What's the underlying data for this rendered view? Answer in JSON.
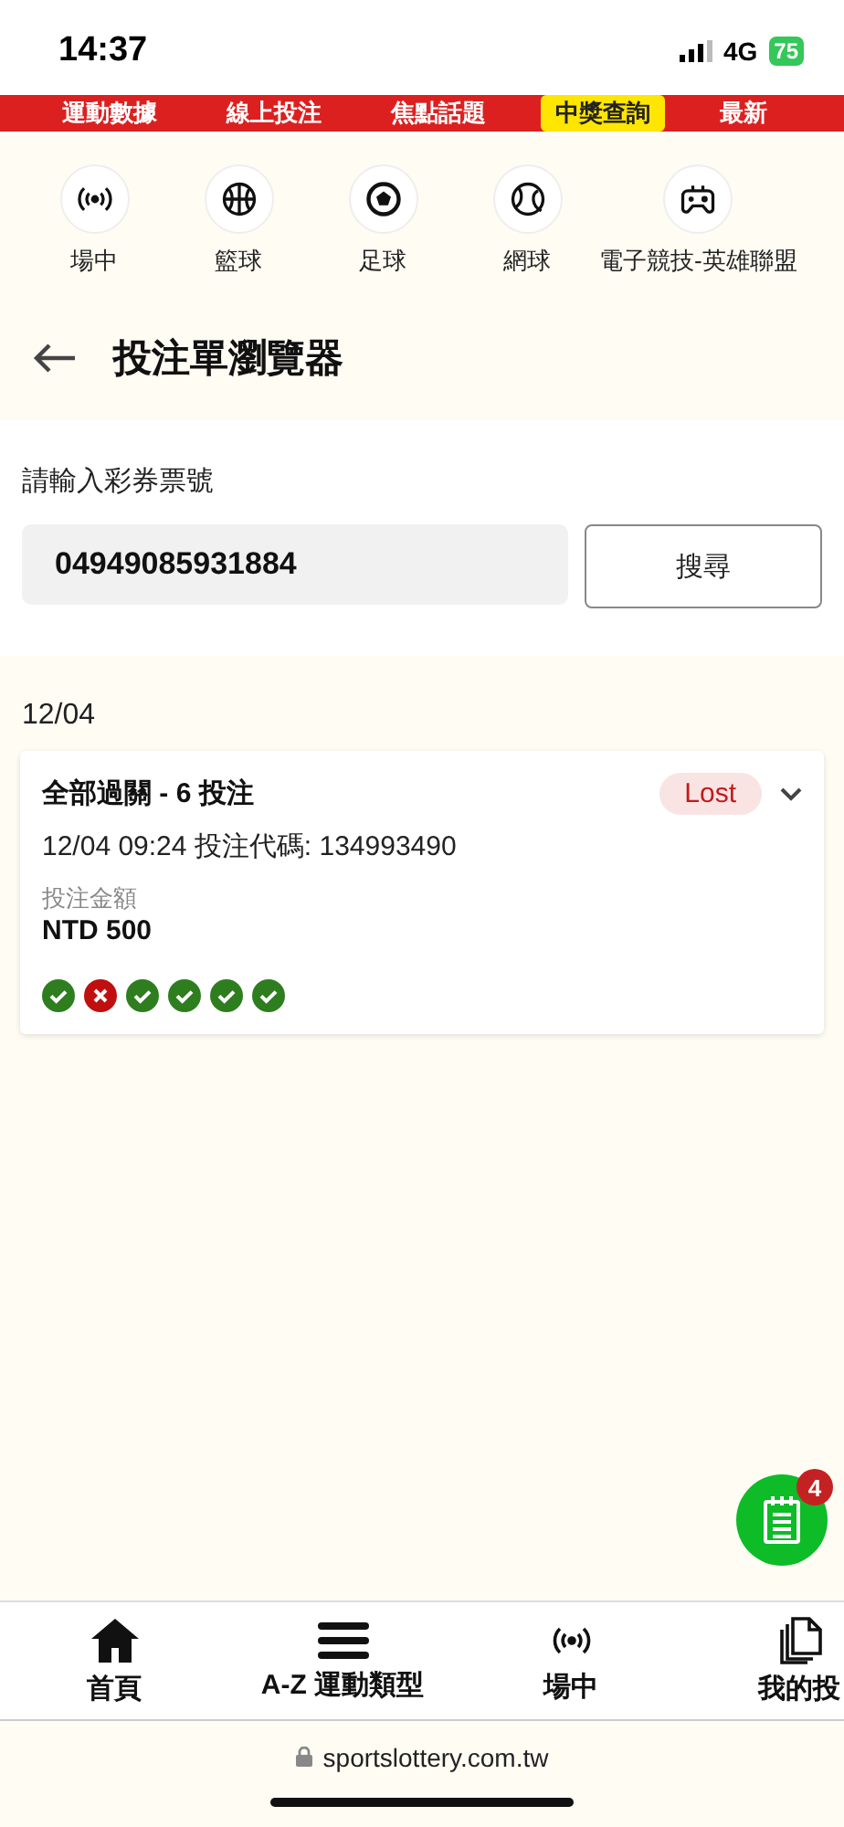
{
  "status_bar": {
    "time": "14:37",
    "network": "4G",
    "battery": "75"
  },
  "top_menu": [
    {
      "label": "運動數據",
      "selected": false
    },
    {
      "label": "線上投注",
      "selected": false
    },
    {
      "label": "焦點話題",
      "selected": false
    },
    {
      "label": "中獎查詢",
      "selected": true
    },
    {
      "label": "最新",
      "selected": false
    }
  ],
  "sports": [
    {
      "kind": "live",
      "label": "場中"
    },
    {
      "kind": "basketball",
      "label": "籃球"
    },
    {
      "kind": "soccer",
      "label": "足球"
    },
    {
      "kind": "tennis",
      "label": "網球"
    },
    {
      "kind": "esports",
      "label": "電子競技-英雄聯盟"
    }
  ],
  "header": {
    "title": "投注單瀏覽器"
  },
  "search": {
    "label": "請輸入彩券票號",
    "value": "04949085931884",
    "button": "搜尋"
  },
  "groups": [
    {
      "date": "12/04",
      "bets": [
        {
          "title": "全部過關 - 6 投注",
          "status": "Lost",
          "details": "12/04 09:24 投注代碼: 134993490",
          "amount_label": "投注金額",
          "amount": "NTD 500",
          "legs": [
            {
              "won": true
            },
            {
              "won": false
            },
            {
              "won": true
            },
            {
              "won": true
            },
            {
              "won": true
            },
            {
              "won": true
            }
          ]
        }
      ]
    }
  ],
  "fab": {
    "badge": "4"
  },
  "bottom_nav": [
    {
      "kind": "home",
      "label": "首頁"
    },
    {
      "kind": "menu",
      "label": "A-Z 運動類型"
    },
    {
      "kind": "live",
      "label": "場中"
    },
    {
      "kind": "bets",
      "label": "我的投"
    }
  ],
  "browser": {
    "url": "sportslottery.com.tw"
  }
}
